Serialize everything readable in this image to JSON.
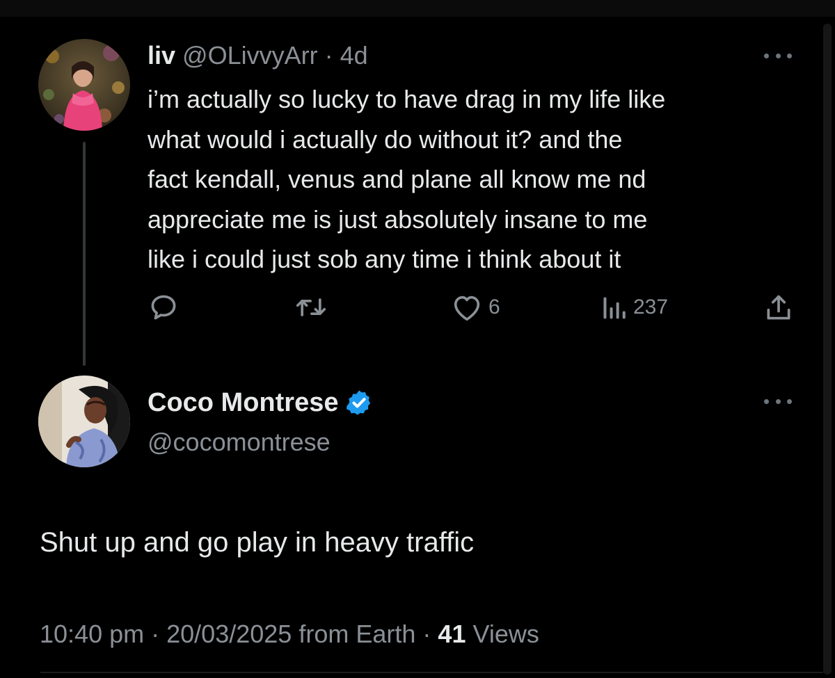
{
  "parent_tweet": {
    "display_name": "liv",
    "handle": "@OLivvyArr",
    "separator": "·",
    "age": "4d",
    "text_lines": [
      "i’m actually so lucky to have drag in my life like",
      "what would i actually do without it? and the",
      "fact kendall, venus and plane all know me nd",
      "appreciate me is just absolutely insane to me",
      "like i could just sob any time i think about it"
    ],
    "actions": {
      "reply_icon": "reply-icon",
      "retweet_icon": "retweet-icon",
      "like_icon": "heart-icon",
      "like_count": "6",
      "views_icon": "views-chart-icon",
      "views_count": "237",
      "share_icon": "share-icon"
    }
  },
  "reply_tweet": {
    "display_name": "Coco Montrese",
    "verified": true,
    "handle": "@cocomontrese",
    "text": "Shut up and go play in heavy traffic",
    "meta": {
      "time": "10:40 pm",
      "sep1": "·",
      "date": "20/03/2025",
      "source": "from Earth",
      "sep2": "·",
      "views_count": "41",
      "views_label": "Views"
    }
  },
  "colors": {
    "background": "#000000",
    "text_primary": "#e7e9ea",
    "text_secondary": "#8b9096",
    "verified_badge": "#1d9bf0",
    "thread_line": "#333639"
  }
}
